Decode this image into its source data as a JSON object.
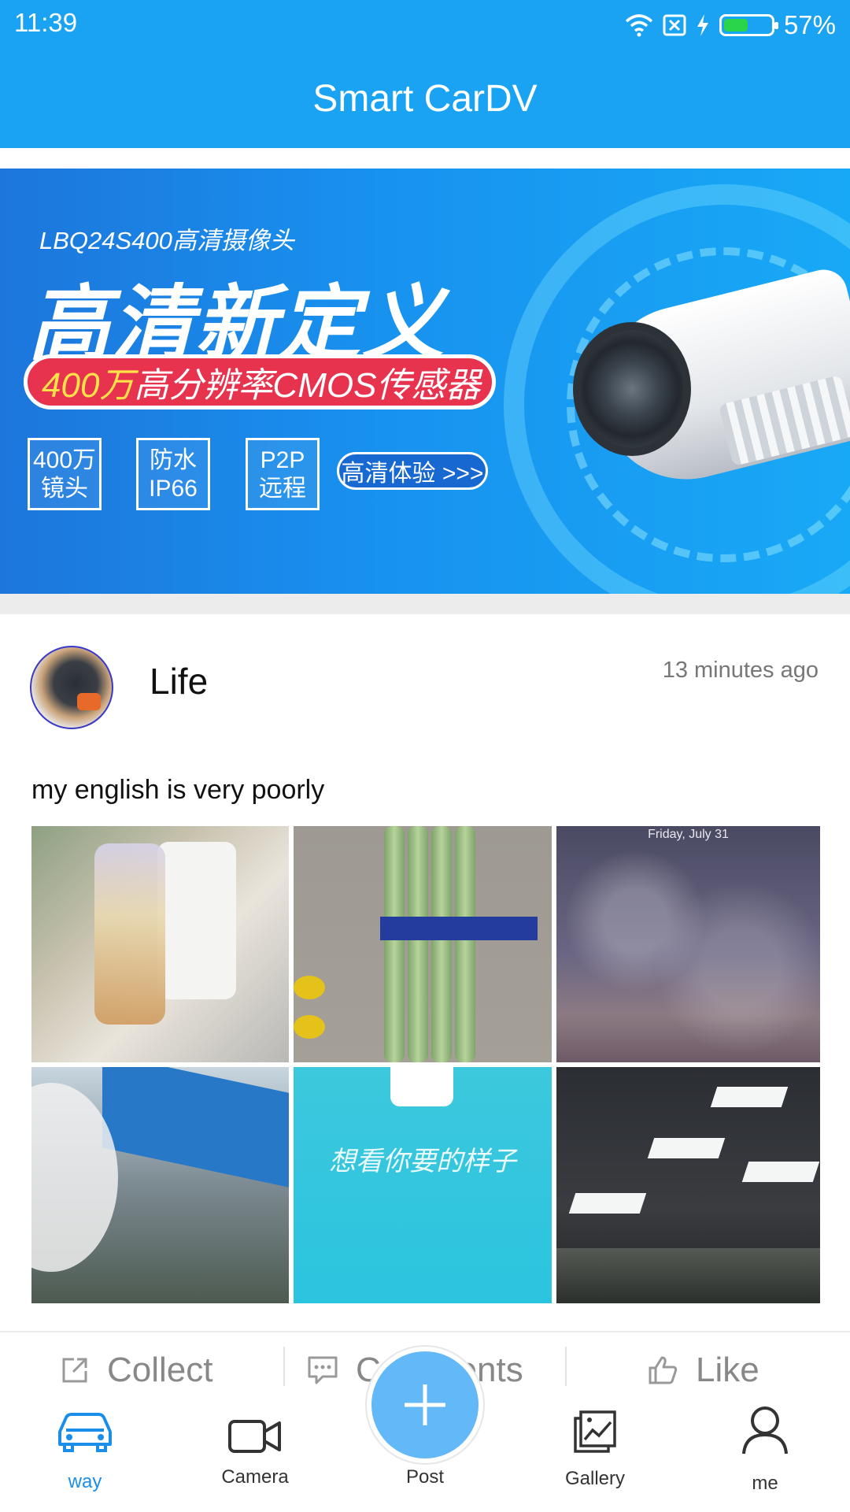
{
  "status_bar": {
    "time": "11:39",
    "battery_percent": "57%",
    "battery_level": 0.57
  },
  "app_bar": {
    "title": "Smart CarDV"
  },
  "banner": {
    "subtitle": "LBQ24S400高清摄像头",
    "headline": "高清新定义",
    "pill_highlight": "400万",
    "pill_text": "高分辨率CMOS传感器",
    "features": [
      {
        "line1": "400万",
        "line2": "镜头"
      },
      {
        "line1": "防水",
        "line2": "IP66"
      },
      {
        "line1": "P2P",
        "line2": "远程"
      }
    ],
    "cta": "高清体验 >>>"
  },
  "post": {
    "author": "Life",
    "time_ago": "13 minutes ago",
    "text": "my english is very  poorly",
    "photo3_caption": "Friday, July 31",
    "photo5_caption": "想看你要的样子"
  },
  "actions": {
    "collect": "Collect",
    "comments": "Comments",
    "like": "Like"
  },
  "tabs": [
    {
      "label": "way",
      "icon": "car-icon",
      "active": true
    },
    {
      "label": "Camera",
      "icon": "video-camera-icon",
      "active": false
    },
    {
      "label": "Post",
      "icon": "plus-icon",
      "active": false
    },
    {
      "label": "Gallery",
      "icon": "gallery-icon",
      "active": false
    },
    {
      "label": "me",
      "icon": "user-icon",
      "active": false
    }
  ],
  "colors": {
    "primary": "#1aa3f2",
    "tab_active": "#1a8ee8",
    "fab": "#63b8f7",
    "pill": "#e8334f"
  }
}
